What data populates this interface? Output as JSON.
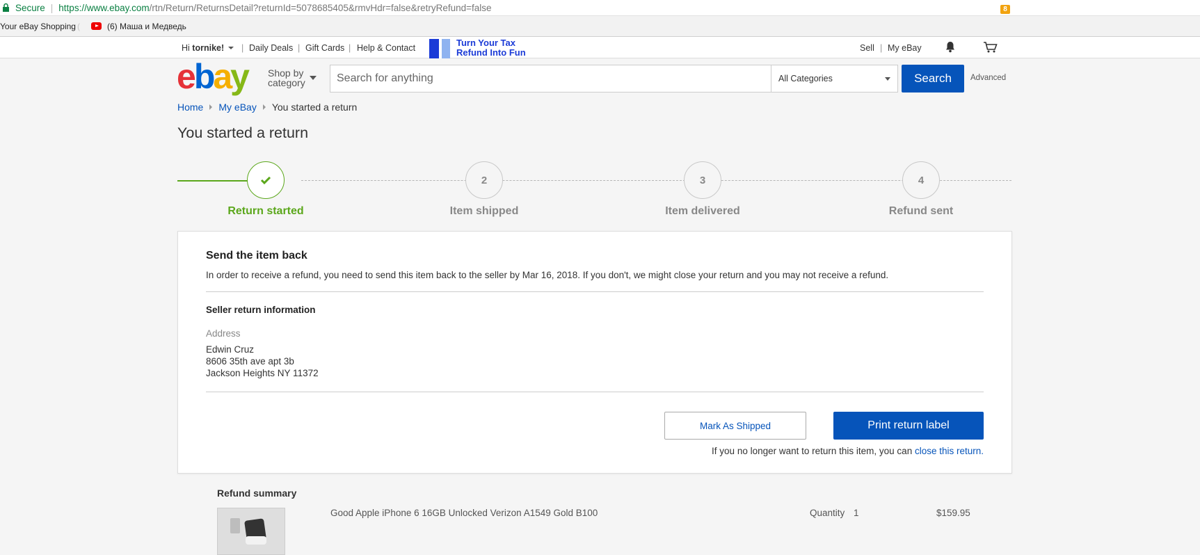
{
  "browser": {
    "secure_label": "Secure",
    "url_host": "https://www.ebay.com",
    "url_path": "/rtn/Return/ReturnsDetail?returnId=5078685405&rmvHdr=false&retryRefund=false",
    "bookmarks": [
      {
        "label": "Your eBay Shopping",
        "fade": "("
      },
      {
        "label": "(6) Маша и Медведь",
        "icon": "youtube-icon"
      }
    ]
  },
  "topnav": {
    "greeting_prefix": "Hi ",
    "user": "tornike!",
    "links": [
      "Daily Deals",
      "Gift Cards",
      "Help & Contact"
    ],
    "promo_line1": "Turn Your Tax",
    "promo_line2": "Refund Into Fun",
    "right_links": [
      "Sell",
      "My eBay"
    ],
    "cart_count": "8"
  },
  "header": {
    "shop_by_line1": "Shop by",
    "shop_by_line2": "category",
    "search_placeholder": "Search for anything",
    "category": "All Categories",
    "search_button": "Search",
    "advanced": "Advanced"
  },
  "breadcrumb": {
    "home": "Home",
    "my_ebay": "My eBay",
    "current": "You started a return"
  },
  "page": {
    "title": "You started a return"
  },
  "steps": [
    {
      "number": "1",
      "label": "Return started",
      "status": "done"
    },
    {
      "number": "2",
      "label": "Item shipped",
      "status": "pending"
    },
    {
      "number": "3",
      "label": "Item delivered",
      "status": "pending"
    },
    {
      "number": "4",
      "label": "Refund sent",
      "status": "pending"
    }
  ],
  "card": {
    "title": "Send the item back",
    "text": "In order to receive a refund, you need to send this item back to the seller by Mar 16, 2018. If you don't, we might close your return and you may not receive a refund.",
    "seller_title": "Seller return information",
    "address_label": "Address",
    "address_lines": [
      "Edwin Cruz",
      "8606 35th ave apt 3b",
      "Jackson Heights NY 11372"
    ],
    "mark_shipped": "Mark As Shipped",
    "print_label": "Print return label",
    "close_note_prefix": "If you no longer want to return this item, you can ",
    "close_link": "close this return."
  },
  "refund": {
    "title": "Refund summary",
    "item_name": "Good Apple iPhone 6 16GB Unlocked Verizon A1549 Gold B100",
    "quantity_label": "Quantity",
    "quantity": "1",
    "price": "$159.95"
  },
  "colors": {
    "brand_blue": "#0654ba",
    "success_green": "#5ba71b",
    "promo_blue": "#1b3bd7",
    "cart_badge": "#f2a30f"
  }
}
